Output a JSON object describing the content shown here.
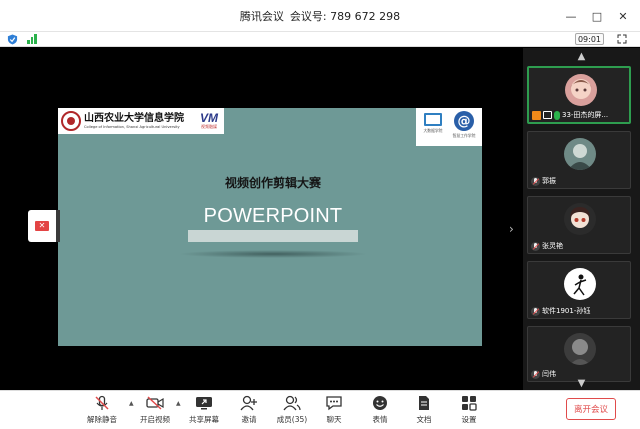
{
  "window": {
    "app_name": "腾讯会议",
    "meeting_label": "会议号: 789 672 298",
    "controls": {
      "minimize": "—",
      "maximize": "□",
      "close": "✕"
    }
  },
  "status": {
    "time": "09:01",
    "security_icon": "shield-icon",
    "network_icon": "signal-icon",
    "fullscreen_icon": "expand-icon"
  },
  "slide": {
    "college_cn": "山西农业大学信息学院",
    "college_en": "College of Information, Shanxi Agricultural University",
    "vm_logo": "VM",
    "vm_sub": "视频融媒",
    "right_logo_caption_1": "大数据学院",
    "right_logo_caption_2": "智慧工作学院",
    "subtitle": "视频创作剪辑大赛",
    "title": "POWERPOINT",
    "background_color": "#6e9996"
  },
  "participants": [
    {
      "name": "33-田杰的屏...",
      "active": true,
      "host": true,
      "sharing": true
    },
    {
      "name": "郭振",
      "active": false
    },
    {
      "name": "张灵艳",
      "active": false
    },
    {
      "name": "软件1901-孙钰",
      "active": false
    },
    {
      "name": "闫伟",
      "active": false
    }
  ],
  "toolbar": {
    "unmute": "解除静音",
    "start_video": "开启视频",
    "share_screen": "共享屏幕",
    "invite": "邀请",
    "members": "成员(35)",
    "chat": "聊天",
    "reactions": "表情",
    "docs": "文档",
    "settings": "设置",
    "leave": "离开会议"
  },
  "colors": {
    "accent_green": "#2bb24c",
    "leave_red": "#e04b4b",
    "slide_teal": "#6e9996"
  }
}
